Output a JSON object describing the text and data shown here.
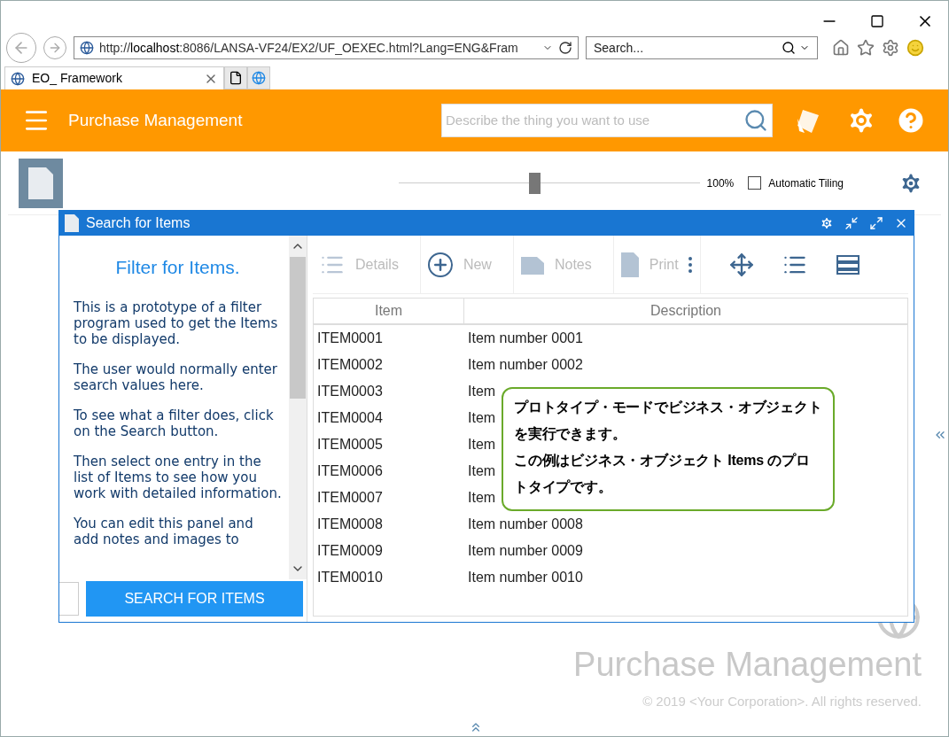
{
  "browser": {
    "address": [
      "http://",
      "localhost",
      ":8086/LANSA-VF24/EX2/UF_OEXEC.html?Lang=ENG&Fram"
    ],
    "search_placeholder": "Search...",
    "tab": "EO_ Framework"
  },
  "header": {
    "title": "Purchase Management",
    "search_placeholder": "Describe the thing you want to use"
  },
  "toolbar": {
    "zoom_slider": {
      "level": 0.45
    },
    "zoom": "100%",
    "automatic_tiling": {
      "label": "Automatic Tiling",
      "checked": false
    }
  },
  "window": {
    "title": "Search for Items",
    "filter": {
      "heading": "Filter for Items.",
      "paragraphs": [
        "This is a prototype of a filter program used to get the Items to be displayed.",
        "The user would normally enter search values here.",
        "To see what a filter does, click on the Search button.",
        "Then select one entry in the list of Items to see how you work with detailed information.",
        "You can edit this panel and add notes and images to"
      ],
      "button": "SEARCH FOR ITEMS"
    },
    "commands": [
      {
        "kind": "details",
        "label": "Details"
      },
      {
        "kind": "new",
        "label": "New"
      },
      {
        "kind": "notes",
        "label": "Notes"
      },
      {
        "kind": "print",
        "label": "Print"
      }
    ],
    "table": {
      "columns": [
        "Item",
        "Description"
      ],
      "rows": [
        [
          "ITEM0001",
          "Item number 0001"
        ],
        [
          "ITEM0002",
          "Item number 0002"
        ],
        [
          "ITEM0003",
          "Item"
        ],
        [
          "ITEM0004",
          "Item"
        ],
        [
          "ITEM0005",
          "Item"
        ],
        [
          "ITEM0006",
          "Item"
        ],
        [
          "ITEM0007",
          "Item"
        ],
        [
          "ITEM0008",
          "Item number 0008"
        ],
        [
          "ITEM0009",
          "Item number 0009"
        ],
        [
          "ITEM0010",
          "Item number 0010"
        ]
      ]
    }
  },
  "callout": {
    "lines": [
      "プロトタイプ・モードでビジネス・オブジェクトを実行できます。",
      "この例はビジネス・オブジェクト Items のプロトタイプです。"
    ]
  },
  "footer": {
    "title": "Purchase Management",
    "copyright": "© 2019 <Your Corporation>. All rights reserved."
  }
}
